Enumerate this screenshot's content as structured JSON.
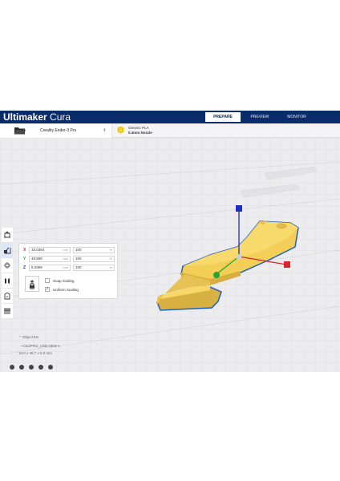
{
  "app": {
    "brand_bold": "Ultimaker",
    "brand_light": " Cura"
  },
  "stages": [
    {
      "label": "PREPARE",
      "active": true
    },
    {
      "label": "PREVIEW",
      "active": false
    },
    {
      "label": "MONITOR",
      "active": false
    }
  ],
  "printer": {
    "name": "Creality Ender-3 Pro"
  },
  "material": {
    "name": "Generic PLA",
    "nozzle": "0.4mm Nozzle"
  },
  "colors": {
    "header": "#0b2c6b",
    "model": "#f6d05c",
    "model_outline": "#1f5fbf",
    "axis_x": "#d8252b",
    "axis_y": "#21a832",
    "axis_z": "#1c2fbf"
  },
  "tools": [
    "move-tool-icon",
    "scale-tool-icon",
    "rotate-tool-icon",
    "mirror-tool-icon",
    "per-model-settings-icon",
    "support-blocker-icon"
  ],
  "scale": {
    "x": {
      "axis": "X",
      "mm": "15.0364",
      "pct": "100",
      "mm_unit": "mm",
      "pct_unit": "%"
    },
    "y": {
      "axis": "Y",
      "mm": "48.698",
      "pct": "100",
      "mm_unit": "mm",
      "pct_unit": "%"
    },
    "z": {
      "axis": "Z",
      "mm": "5.0369",
      "pct": "100",
      "mm_unit": "mm",
      "pct_unit": "%"
    },
    "snap_label": "Snap Scaling",
    "uniform_label": "Uniform Scaling",
    "snap_checked": false,
    "uniform_checked": true
  },
  "object_list": {
    "header": "Object list",
    "item": "CE3PRO_USB NEW A",
    "dims": "15.0 x 48.7 x 5.0 mm"
  }
}
